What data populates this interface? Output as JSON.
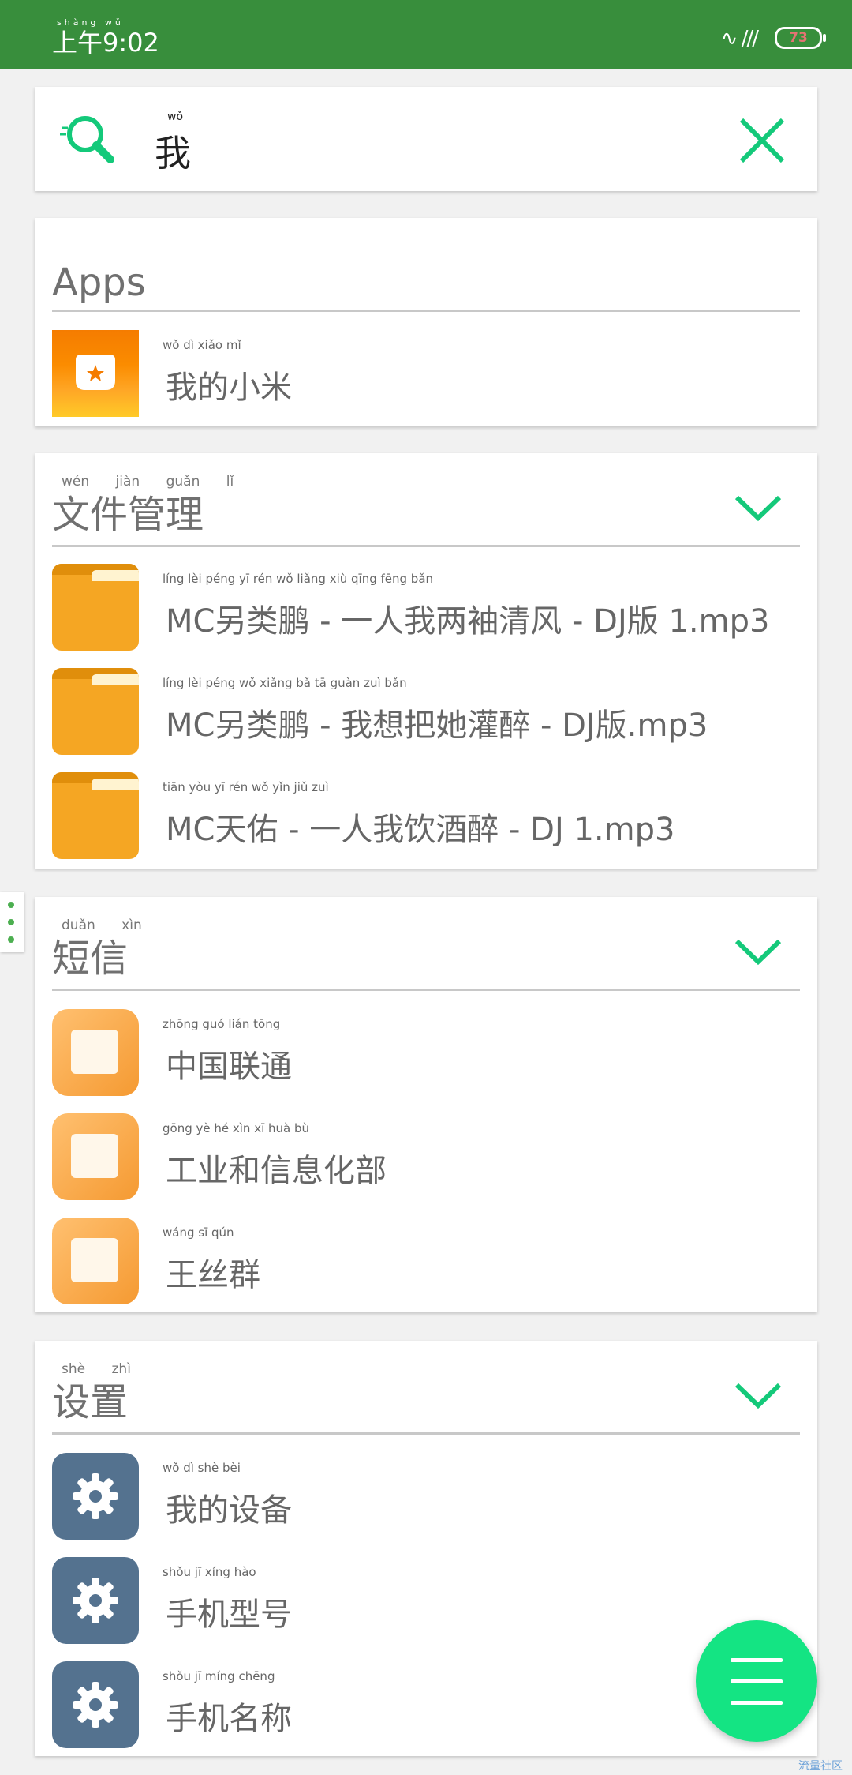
{
  "status_bar": {
    "time": "上午9:02",
    "time_pinyin": "shàng wǔ",
    "signal": "∿ ///",
    "battery": "73"
  },
  "search": {
    "query": "我",
    "query_pinyin": "wǒ"
  },
  "sections": {
    "apps": {
      "title": "Apps",
      "items": [
        {
          "label": "我的小米",
          "pinyin": "wǒ   dì   xiǎo   mǐ",
          "icon": "mi-app-icon"
        }
      ]
    },
    "files": {
      "title": "文件管理",
      "pinyin": "wén jiàn guǎn lǐ",
      "items": [
        {
          "label": "MC另类鹏 - 一人我两袖清风 - DJ版 1.mp3",
          "pinyin": "líng lèi péng    yī rén wǒ liǎng xiù qīng fēng    bǎn"
        },
        {
          "label": "MC另类鹏 - 我想把她灌醉 - DJ版.mp3",
          "pinyin": "líng lèi péng    wǒ xiǎng bǎ tā guàn zuì    bǎn"
        },
        {
          "label": "MC天佑 - 一人我饮酒醉 - DJ 1.mp3",
          "pinyin": "tiān yòu    yī rén wǒ yǐn jiǔ zuì"
        }
      ]
    },
    "sms": {
      "title": "短信",
      "pinyin": "duǎn xìn",
      "items": [
        {
          "label": "中国联通",
          "pinyin": "zhōng  guó  lián  tōng"
        },
        {
          "label": "工业和信息化部",
          "pinyin": "gōng  yè  hé  xìn  xī  huà  bù"
        },
        {
          "label": "王丝群",
          "pinyin": "wáng  sī  qún"
        }
      ]
    },
    "settings": {
      "title": "设置",
      "pinyin": "shè zhì",
      "items": [
        {
          "label": "我的设备",
          "pinyin": "wǒ  dì  shè  bèi"
        },
        {
          "label": "手机型号",
          "pinyin": "shǒu  jī  xíng  hào"
        },
        {
          "label": "手机名称",
          "pinyin": "shǒu  jī  míng  chēng"
        }
      ]
    }
  },
  "watermark": "流量社区",
  "colors": {
    "status_bar": "#388e3c",
    "accent": "#14e483",
    "file_icon": "#f5a623",
    "gear_icon": "#54728f"
  }
}
